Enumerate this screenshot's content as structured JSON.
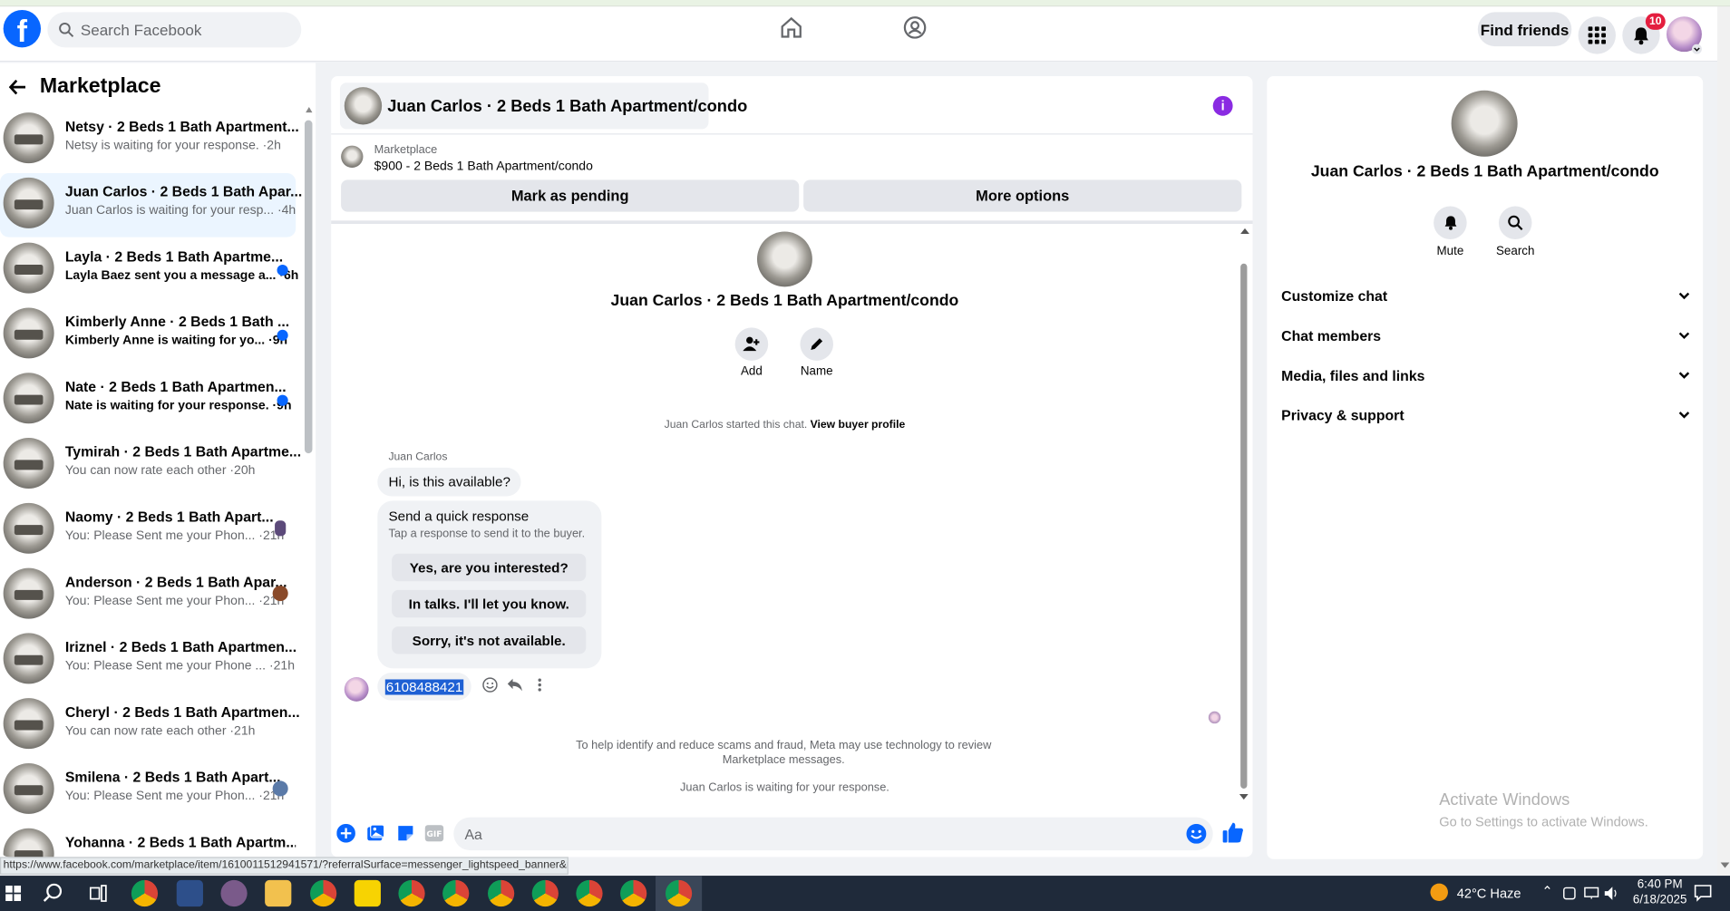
{
  "topbar": {
    "search_placeholder": "Search Facebook",
    "find_friends": "Find friends",
    "notification_count": "10"
  },
  "sidebar": {
    "title": "Marketplace",
    "conversations": [
      {
        "title": "Netsy · 2 Beds 1 Bath Apartment...",
        "preview": "Netsy is waiting for your response. ·2h",
        "unread": false
      },
      {
        "title": "Juan Carlos · 2 Beds 1 Bath Apar...",
        "preview": "Juan Carlos is waiting for your resp... ·4h",
        "unread": false,
        "active": true
      },
      {
        "title": "Layla · 2 Beds 1 Bath Apartme...",
        "preview": "Layla Baez sent you a message a... ·6h",
        "unread": true
      },
      {
        "title": "Kimberly Anne · 2 Beds 1 Bath ...",
        "preview": "Kimberly Anne is waiting for yo... ·9h",
        "unread": true
      },
      {
        "title": "Nate · 2 Beds 1 Bath Apartmen...",
        "preview": "Nate is waiting for your response. ·9h",
        "unread": true
      },
      {
        "title": "Tymirah · 2 Beds 1 Bath Apartme...",
        "preview": "You can now rate each other ·20h",
        "unread": false
      },
      {
        "title": "Naomy · 2 Beds 1 Bath Apart...",
        "preview": "You: Please Sent me your Phon... ·21h",
        "unread": false
      },
      {
        "title": "Anderson · 2 Beds 1 Bath Apar...",
        "preview": "You: Please Sent me your Phon... ·21h",
        "unread": false
      },
      {
        "title": "Iriznel · 2 Beds 1 Bath Apartmen...",
        "preview": "You: Please Sent me your Phone ... ·21h",
        "unread": false
      },
      {
        "title": "Cheryl · 2 Beds 1 Bath Apartmen...",
        "preview": "You can now rate each other ·21h",
        "unread": false
      },
      {
        "title": "Smilena · 2 Beds 1 Bath Apart...",
        "preview": "You: Please Sent me your Phon... ·21h",
        "unread": false
      },
      {
        "title": "Yohanna · 2 Beds 1 Bath Apartm...",
        "preview": "",
        "unread": false
      }
    ]
  },
  "chat": {
    "header_title": "Juan Carlos · 2 Beds 1 Bath Apartment/condo",
    "marketplace_label": "Marketplace",
    "listing": "$900 - 2 Beds 1 Bath Apartment/condo",
    "mark_pending": "Mark as pending",
    "more_options": "More options",
    "intro_title": "Juan Carlos · 2 Beds 1 Bath Apartment/condo",
    "add_label": "Add",
    "name_label": "Name",
    "started_text": "Juan Carlos started this chat.",
    "view_profile": "View buyer profile",
    "sender": "Juan Carlos",
    "message": "Hi, is this available?",
    "quick_title": "Send a quick response",
    "quick_sub": "Tap a response to send it to the buyer.",
    "quick_replies": [
      "Yes, are you interested?",
      "In talks. I'll let you know.",
      "Sorry, it's not available."
    ],
    "my_message": "6108488421",
    "notice": "To help identify and reduce scams and fraud, Meta may use technology to review Marketplace messages.",
    "waiting": "Juan Carlos is waiting for your response.",
    "composer_placeholder": "Aa"
  },
  "details": {
    "title": "Juan Carlos · 2 Beds 1 Bath Apartment/condo",
    "mute": "Mute",
    "search": "Search",
    "sections": [
      "Customize chat",
      "Chat members",
      "Media, files and links",
      "Privacy & support"
    ]
  },
  "watermark": {
    "line1": "Activate Windows",
    "line2": "Go to Settings to activate Windows."
  },
  "status_url": "https://www.facebook.com/marketplace/item/1610011512941571/?referralSurface=messenger_lightspeed_banner&r...",
  "taskbar": {
    "weather": "42°C  Haze",
    "time": "6:40 PM",
    "date": "6/18/2025"
  },
  "colors": {
    "brand": "#0866ff",
    "info": "#8a2be2",
    "badge": "#e41e3f"
  }
}
